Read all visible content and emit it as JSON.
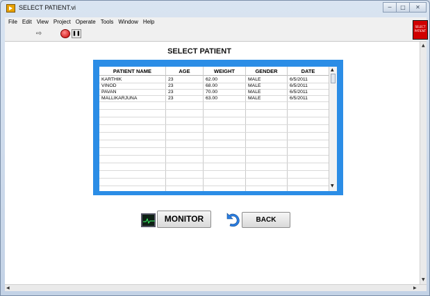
{
  "window": {
    "title": "SELECT PATIENT.vi"
  },
  "menus": [
    "File",
    "Edit",
    "View",
    "Project",
    "Operate",
    "Tools",
    "Window",
    "Help"
  ],
  "vi_icon_text": "SELECT PATIENT",
  "panel": {
    "heading": "SELECT PATIENT"
  },
  "table": {
    "headers": [
      "PATIENT NAME",
      "AGE",
      "WEIGHT",
      "GENDER",
      "DATE"
    ],
    "rows": [
      [
        "KARTHIK",
        "23",
        "62.00",
        "MALE",
        "6/5/2011"
      ],
      [
        "VINOD",
        "23",
        "68.00",
        "MALE",
        "6/5/2011"
      ],
      [
        "PAVAN",
        "23",
        "70.00",
        "MALE",
        "6/5/2011"
      ],
      [
        "MALLIKARJUNA",
        "23",
        "63.00",
        "MALE",
        "6/5/2011"
      ]
    ]
  },
  "buttons": {
    "monitor": "MONITOR",
    "back": "BACK"
  },
  "colors": {
    "table_frame": "#2b8de6"
  }
}
